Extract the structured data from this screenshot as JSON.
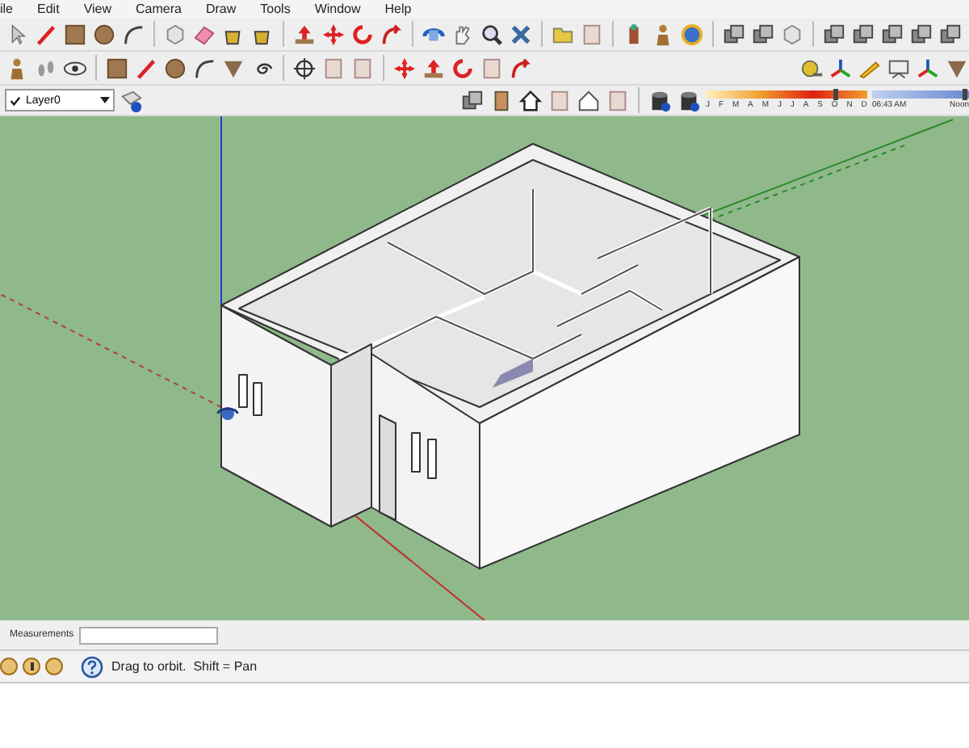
{
  "menu": [
    "ile",
    "Edit",
    "View",
    "Camera",
    "Draw",
    "Tools",
    "Window",
    "Help"
  ],
  "layer": {
    "value": "Layer0",
    "checked": true
  },
  "shadows": {
    "months": [
      "J",
      "F",
      "M",
      "A",
      "M",
      "J",
      "J",
      "A",
      "S",
      "O",
      "N",
      "D"
    ],
    "month_slider": {
      "level": 0.8
    },
    "time": "06:43 AM",
    "noon": "Noon",
    "time_slider": {
      "level": 0.95
    }
  },
  "measurements": {
    "label": "Measurements"
  },
  "status": {
    "text": "Drag to orbit.  Shift = Pan"
  }
}
